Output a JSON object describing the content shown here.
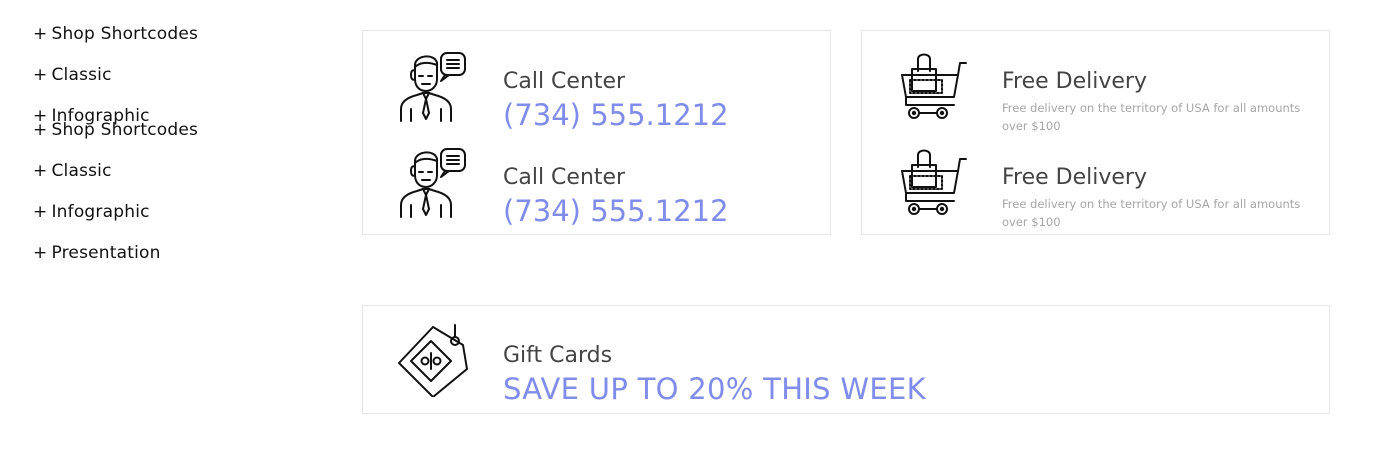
{
  "menu_group_1": [
    {
      "marker": "+",
      "label": "Shop Shortcodes"
    },
    {
      "marker": "+",
      "label": "Classic"
    },
    {
      "marker": "+",
      "label": "Infographic"
    }
  ],
  "menu_group_2": [
    {
      "marker": "+",
      "label": "Shop Shortcodes"
    },
    {
      "marker": "+",
      "label": "Classic"
    },
    {
      "marker": "+",
      "label": "Infographic"
    },
    {
      "marker": "+",
      "label": "Presentation"
    }
  ],
  "call_center": [
    {
      "title": "Call Center",
      "phone": "(734) 555.1212",
      "icon": "call-center-agent-icon"
    },
    {
      "title": "Call Center",
      "phone": "(734) 555.1212",
      "icon": "call-center-agent-icon"
    }
  ],
  "free_delivery": [
    {
      "title": "Free Delivery",
      "description": "Free delivery on the territory of USA for all amounts over $100",
      "icon": "shopping-cart-bag-icon"
    },
    {
      "title": "Free Delivery",
      "description": "Free delivery on the territory of USA for all amounts over $100",
      "icon": "shopping-cart-bag-icon"
    }
  ],
  "gift_cards": {
    "title": "Gift Cards",
    "promo": "SAVE UP TO 20% THIS WEEK",
    "icon": "discount-tag-icon"
  },
  "colors": {
    "accent": "#7f8cea",
    "title_text": "#444444",
    "description_text": "#a6a6a6",
    "border": "#e6e6e6",
    "menu_text": "#111111"
  }
}
